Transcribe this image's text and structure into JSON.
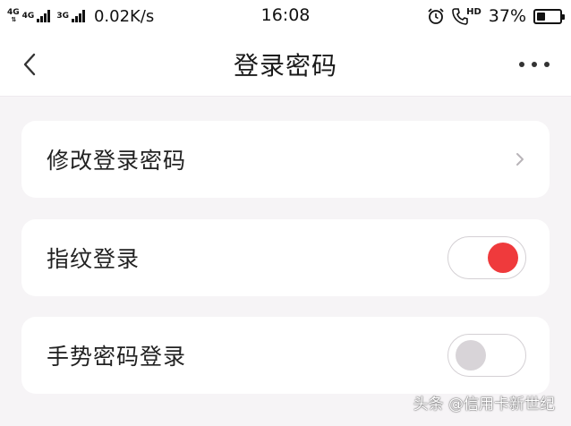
{
  "status_bar": {
    "network_1": "4G",
    "network_2": "4G",
    "network_3": "3G",
    "speed": "0.02K/s",
    "time": "16:08",
    "hd": "HD",
    "battery": "37%",
    "battery_level": 0.37
  },
  "nav": {
    "title": "登录密码",
    "back_icon": "chevron-left-icon",
    "more_icon": "more-horizontal-icon"
  },
  "settings": {
    "change_password": {
      "label": "修改登录密码"
    },
    "fingerprint": {
      "label": "指纹登录",
      "enabled": true
    },
    "gesture": {
      "label": "手势密码登录",
      "enabled": false
    }
  },
  "colors": {
    "accent": "#ef3a3c",
    "toggle_off_knob": "#d8d4d8",
    "background": "#f6f4f6"
  },
  "watermark": "头条 @信用卡新世纪"
}
